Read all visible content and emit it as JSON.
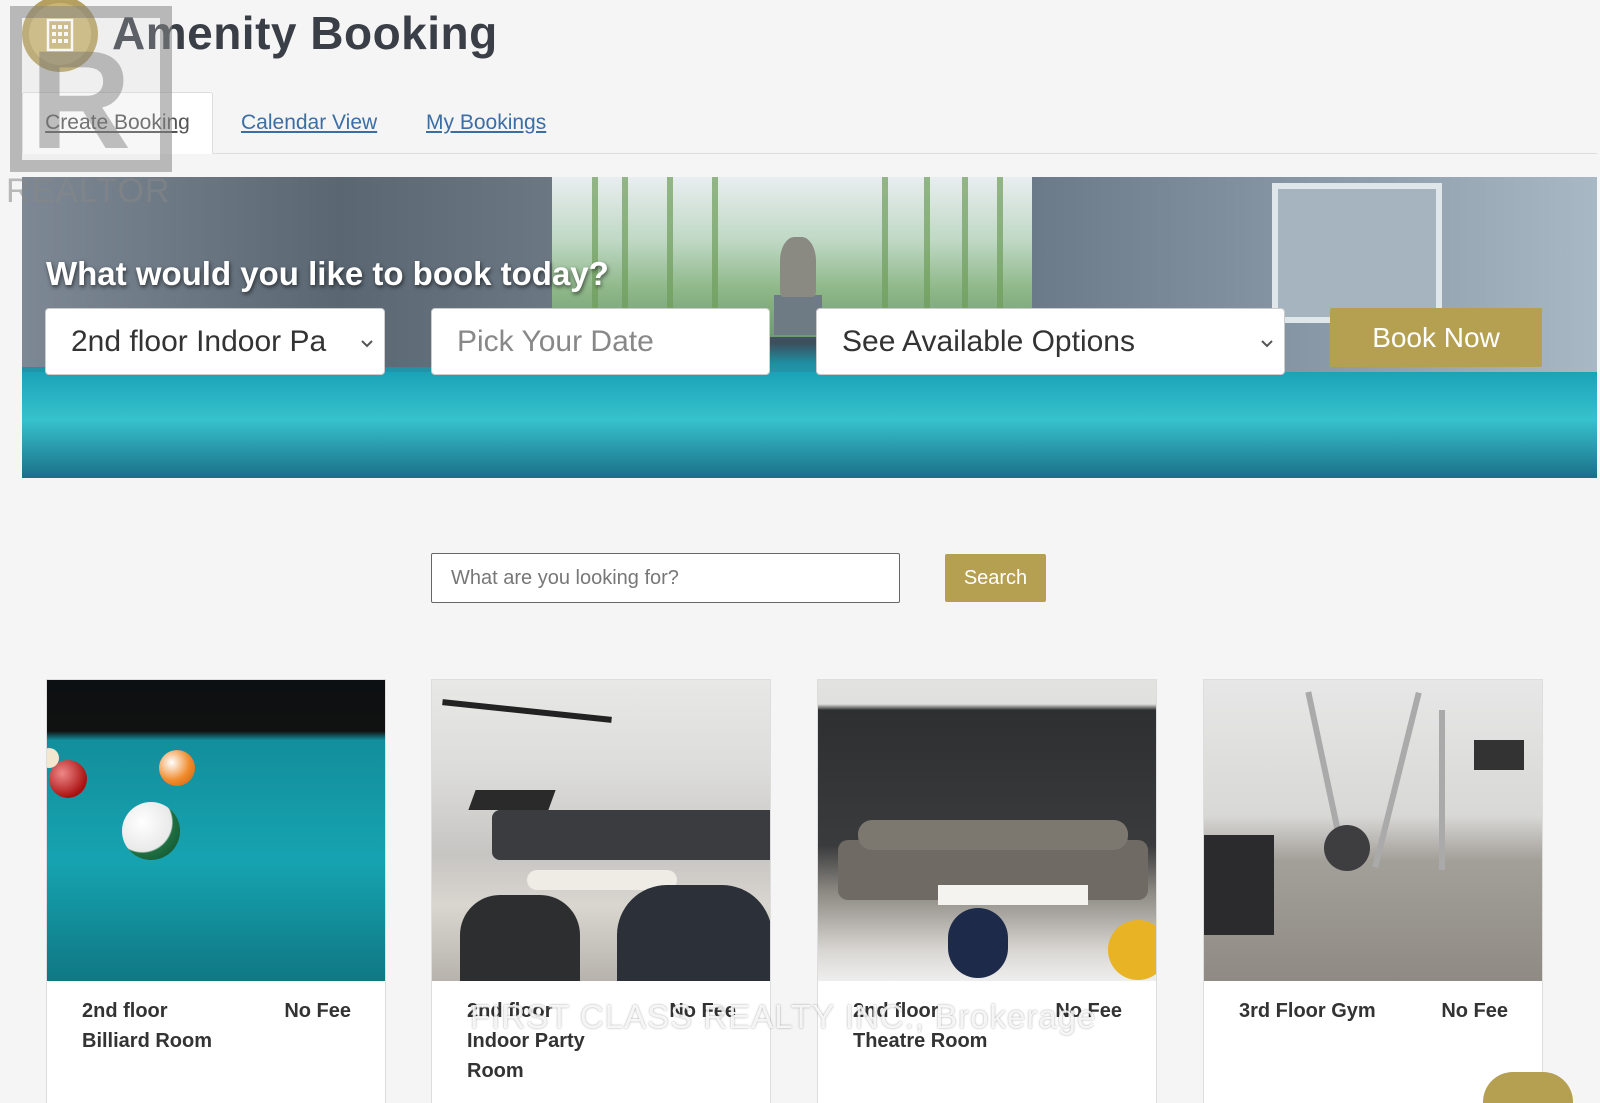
{
  "header": {
    "title": "Amenity Booking"
  },
  "tabs": [
    {
      "label": "Create Booking",
      "active": true
    },
    {
      "label": "Calendar View",
      "active": false
    },
    {
      "label": "My Bookings",
      "active": false
    }
  ],
  "hero": {
    "question": "What would you like to book today?",
    "amenity_select_value": "2nd floor Indoor Pa",
    "date_placeholder": "Pick Your Date",
    "options_select_value": "See Available Options",
    "book_button": "Book Now"
  },
  "search": {
    "placeholder": "What are you looking for?",
    "button": "Search"
  },
  "cards": [
    {
      "name": "2nd floor Billiard Room",
      "fee": "No Fee"
    },
    {
      "name": "2nd floor Indoor Party Room",
      "fee": "No Fee"
    },
    {
      "name": "2nd floor Theatre Room",
      "fee": "No Fee"
    },
    {
      "name": "3rd Floor Gym",
      "fee": "No Fee"
    }
  ],
  "watermarks": {
    "realtor": "REALTOR",
    "brokerage": "FIRST CLASS REALTY INC., Brokerage"
  },
  "colors": {
    "accent": "#b5a052",
    "link": "#3b6ea5"
  }
}
